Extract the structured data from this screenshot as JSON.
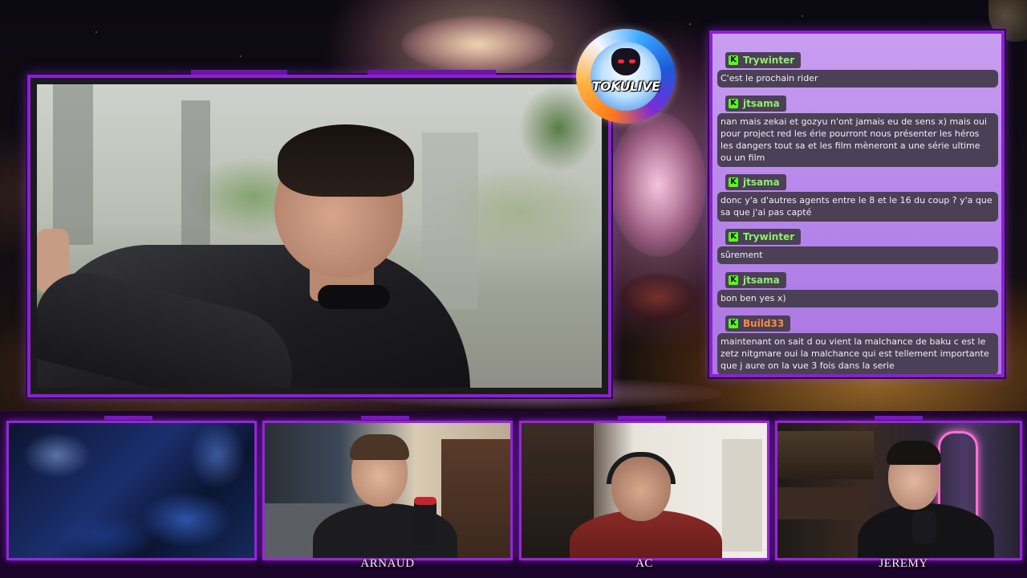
{
  "overlay": {
    "logo_text": "TOKULIVE",
    "accent_color": "#8d1fd3"
  },
  "chat": {
    "platform_icon": "kick-icon",
    "messages": [
      {
        "user": "Trywinter",
        "user_color": "#8ef06b",
        "text": "C'est le prochain rider"
      },
      {
        "user": "jtsama",
        "user_color": "#8ef06b",
        "text": "nan mais zekai et gozyu n'ont jamais eu de sens x) mais oui pour project red les érie pourront nous présenter les héros les dangers tout sa et les film mèneront a une série ultime ou un film"
      },
      {
        "user": "jtsama",
        "user_color": "#8ef06b",
        "text": "donc y'a d'autres agents entre le 8 et le 16 du coup ? y'a que sa que j'ai pas capté"
      },
      {
        "user": "Trywinter",
        "user_color": "#8ef06b",
        "text": "sûrement"
      },
      {
        "user": "jtsama",
        "user_color": "#8ef06b",
        "text": "bon ben yes x)"
      },
      {
        "user": "Build33",
        "user_color": "#ff8a3c",
        "text": "maintenant on sait d ou vient la malchance de baku c est le zetz nitgmare oui la malchance qui est tellement importante que j aure on la vue 3 fois dans la serie"
      }
    ]
  },
  "cams": [
    {
      "label": ""
    },
    {
      "label": "ARNAUD"
    },
    {
      "label": "AC"
    },
    {
      "label": "JEREMY"
    }
  ]
}
